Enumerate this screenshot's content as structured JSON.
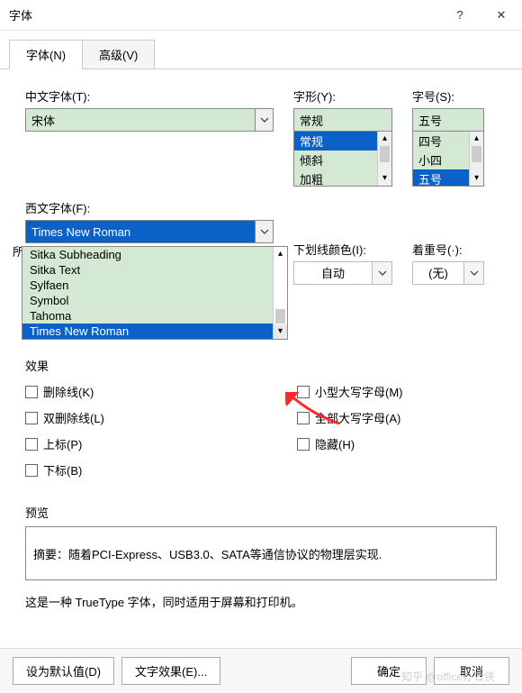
{
  "window": {
    "title": "字体",
    "help": "?",
    "close": "✕"
  },
  "tabs": {
    "font": "字体(N)",
    "advanced": "高级(V)"
  },
  "labels": {
    "cn_font": "中文字体(T):",
    "font_style": "字形(Y):",
    "font_size": "字号(S):",
    "west_font": "西文字体(F):",
    "underline_color": "下划线颜色(I):",
    "emphasis": "着重号(·):",
    "all_fonts_prefix": "所",
    "effects": "效果",
    "preview": "预览",
    "note": "这是一种 TrueType 字体，同时适用于屏幕和打印机。"
  },
  "values": {
    "cn_font": "宋体",
    "font_style": "常规",
    "font_size": "五号",
    "west_font": "Times New Roman",
    "underline_color": "自动",
    "emphasis": "(无)",
    "preview_text": "摘要：随着PCI-Express、USB3.0、SATA等通信协议的物理层实现."
  },
  "font_style_list": [
    "常规",
    "倾斜",
    "加粗"
  ],
  "font_size_list": [
    "四号",
    "小四",
    "五号"
  ],
  "west_dropdown": [
    "Sitka Subheading",
    "Sitka Text",
    "Sylfaen",
    "Symbol",
    "Tahoma",
    "Times New Roman"
  ],
  "effects_left": [
    {
      "label": "删除线(K)"
    },
    {
      "label": "双删除线(L)"
    },
    {
      "label": "上标(P)"
    },
    {
      "label": "下标(B)"
    }
  ],
  "effects_right": [
    {
      "label": "小型大写字母(M)"
    },
    {
      "label": "全部大写字母(A)"
    },
    {
      "label": "隐藏(H)"
    }
  ],
  "footer": {
    "set_default": "设为默认值(D)",
    "text_effects": "文字效果(E)...",
    "ok": "确定",
    "cancel": "取消"
  },
  "watermark": "知乎 @office办公侠"
}
